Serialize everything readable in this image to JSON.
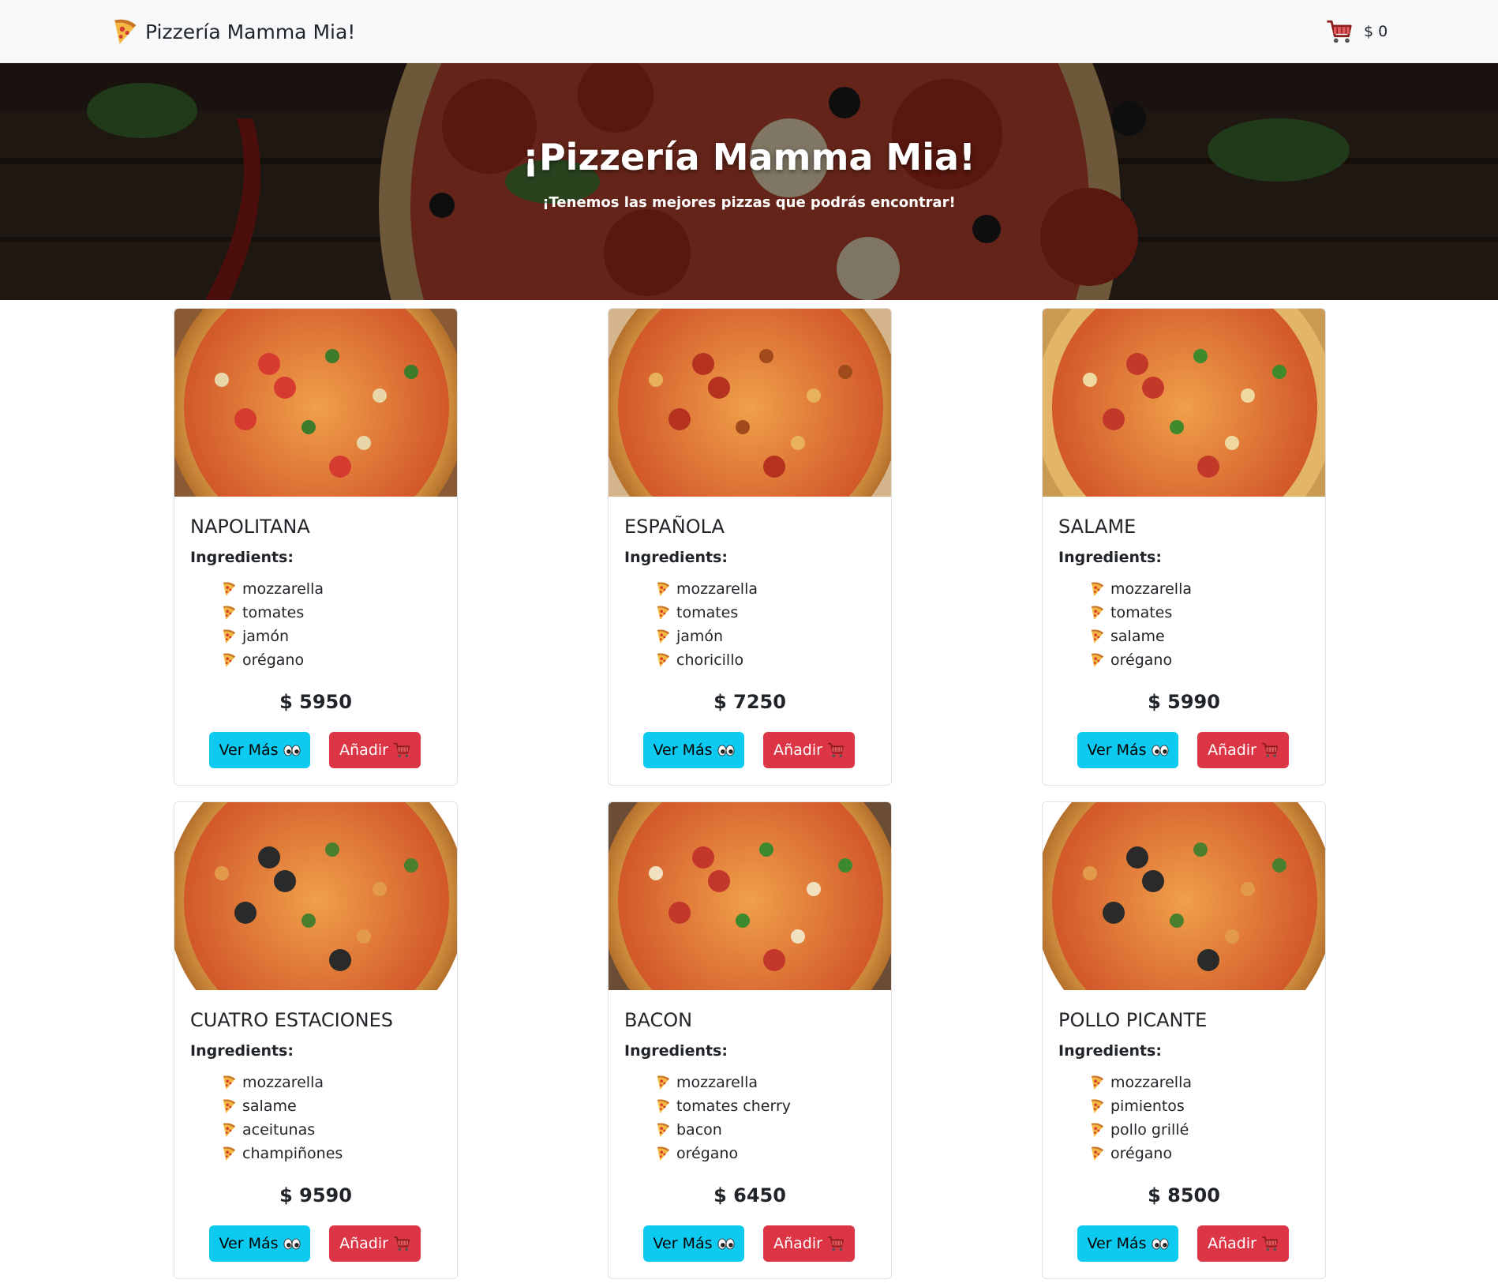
{
  "navbar": {
    "brand_icon": "pizza-slice-icon",
    "brand": "Pizzería Mamma Mia!",
    "cart_icon": "shopping-cart-icon",
    "cart_total": "$ 0"
  },
  "hero": {
    "title": "¡Pizzería Mamma Mia!",
    "subtitle": "¡Tenemos las mejores pizzas que podrás encontrar!"
  },
  "labels": {
    "ingredients": "Ingredients:",
    "ver_mas": "Ver Más",
    "anadir": "Añadir"
  },
  "colors": {
    "info": "#0dcaf0",
    "danger": "#dc3545",
    "navbar_bg": "#f8f9fa"
  },
  "pizzas": [
    {
      "name": "NAPOLITANA",
      "ingredients": [
        "mozzarella",
        "tomates",
        "jamón",
        "orégano"
      ],
      "price": "$ 5950"
    },
    {
      "name": "ESPAÑOLA",
      "ingredients": [
        "mozzarella",
        "tomates",
        "jamón",
        "choricillo"
      ],
      "price": "$ 7250"
    },
    {
      "name": "SALAME",
      "ingredients": [
        "mozzarella",
        "tomates",
        "salame",
        "orégano"
      ],
      "price": "$ 5990"
    },
    {
      "name": "CUATRO ESTACIONES",
      "ingredients": [
        "mozzarella",
        "salame",
        "aceitunas",
        "champiñones"
      ],
      "price": "$ 9590"
    },
    {
      "name": "BACON",
      "ingredients": [
        "mozzarella",
        "tomates cherry",
        "bacon",
        "orégano"
      ],
      "price": "$ 6450"
    },
    {
      "name": "POLLO PICANTE",
      "ingredients": [
        "mozzarella",
        "pimientos",
        "pollo grillé",
        "orégano"
      ],
      "price": "$ 8500"
    }
  ]
}
